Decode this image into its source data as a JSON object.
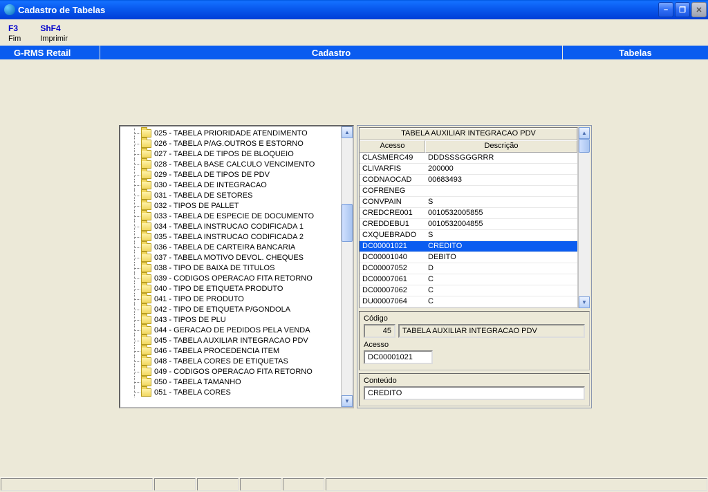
{
  "window": {
    "title": "Cadastro de Tabelas"
  },
  "toolbar": [
    {
      "key": "F3",
      "label": "Fim"
    },
    {
      "key": "ShF4",
      "label": "Imprimir"
    }
  ],
  "breadcrumb": {
    "left": "G-RMS Retail",
    "mid": "Cadastro",
    "right": "Tabelas"
  },
  "tree": [
    "025 - TABELA PRIORIDADE ATENDIMENTO",
    "026 - TABELA P/AG.OUTROS E ESTORNO",
    "027 - TABELA DE TIPOS DE BLOQUEIO",
    "028 - TABELA BASE CALCULO VENCIMENTO",
    "029 - TABELA DE TIPOS DE PDV",
    "030 - TABELA DE INTEGRACAO",
    "031 - TABELA DE SETORES",
    "032 - TIPOS DE PALLET",
    "033 - TABELA DE ESPECIE DE DOCUMENTO",
    "034 - TABELA INSTRUCAO CODIFICADA 1",
    "035 - TABELA INSTRUCAO CODIFICADA 2",
    "036 - TABELA DE CARTEIRA BANCARIA",
    "037 - TABELA MOTIVO DEVOL. CHEQUES",
    "038 - TIPO DE BAIXA DE TITULOS",
    "039 - CODIGOS OPERACAO FITA RETORNO",
    "040 - TIPO DE ETIQUETA PRODUTO",
    "041 - TIPO DE PRODUTO",
    "042 - TIPO DE ETIQUETA P/GONDOLA",
    "043 - TIPOS DE PLU",
    "044 - GERACAO DE PEDIDOS PELA VENDA",
    "045 - TABELA AUXILIAR INTEGRACAO PDV",
    "046 - TABELA PROCEDENCIA ITEM",
    "048 - TABELA CORES DE ETIQUETAS",
    "049 - CODIGOS OPERACAO FITA RETORNO",
    "050 - TABELA TAMANHO",
    "051 - TABELA CORES"
  ],
  "grid": {
    "title": "TABELA AUXILIAR INTEGRACAO PDV",
    "cols": {
      "acesso": "Acesso",
      "descricao": "Descrição"
    },
    "rows": [
      {
        "acesso": "CLASMERC49",
        "desc": "DDDSSSGGGRRR"
      },
      {
        "acesso": "CLIVARFIS",
        "desc": "200000"
      },
      {
        "acesso": "CODNAOCAD",
        "desc": "00683493"
      },
      {
        "acesso": "COFRENEG",
        "desc": ""
      },
      {
        "acesso": "CONVPAIN",
        "desc": "S"
      },
      {
        "acesso": "CREDCRE001",
        "desc": "0010532005855"
      },
      {
        "acesso": "CREDDEBU1",
        "desc": "0010532004855"
      },
      {
        "acesso": "CXQUEBRADO",
        "desc": "S"
      },
      {
        "acesso": "DC00001021",
        "desc": "CREDITO",
        "sel": true
      },
      {
        "acesso": "DC00001040",
        "desc": "DEBITO"
      },
      {
        "acesso": "DC00007052",
        "desc": "D"
      },
      {
        "acesso": "DC00007061",
        "desc": "C"
      },
      {
        "acesso": "DC00007062",
        "desc": "C"
      },
      {
        "acesso": "DU00007064",
        "desc": "C"
      }
    ]
  },
  "form": {
    "codigo_label": "Código",
    "codigo_value": "45",
    "nome_value": "TABELA AUXILIAR INTEGRACAO PDV",
    "acesso_label": "Acesso",
    "acesso_value": "DC00001021",
    "conteudo_label": "Conteúdo",
    "conteudo_value": "CREDITO"
  }
}
